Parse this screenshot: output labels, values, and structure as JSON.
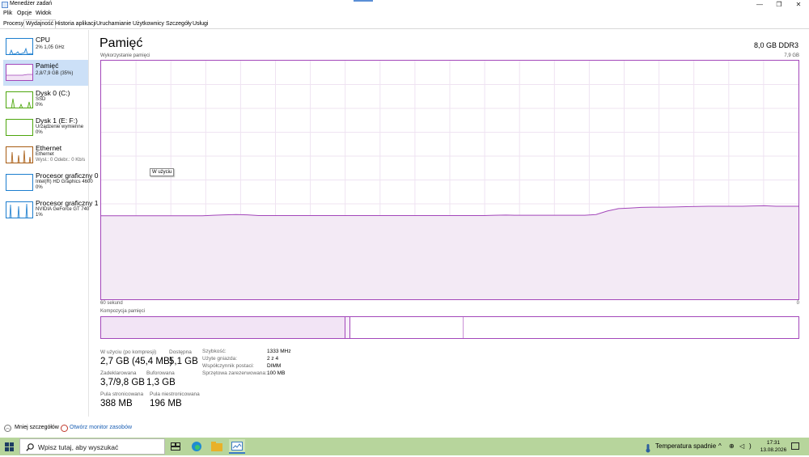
{
  "window": {
    "title": "Menedżer zadań",
    "controls": {
      "minimize": "—",
      "restore": "❐",
      "close": "✕"
    }
  },
  "menu": {
    "file": "Plik",
    "options": "Opcje",
    "view": "Widok"
  },
  "tabs": [
    {
      "label": "Procesy"
    },
    {
      "label": "Wydajność",
      "active": true
    },
    {
      "label": "Historia aplikacji"
    },
    {
      "label": "Uruchamianie"
    },
    {
      "label": "Użytkownicy"
    },
    {
      "label": "Szczegóły"
    },
    {
      "label": "Usługi"
    }
  ],
  "sidebar": {
    "items": [
      {
        "name": "CPU",
        "line1": "2% 1,05 GHz",
        "color": "#1c7ecf"
      },
      {
        "name": "Pamięć",
        "line1": "2,8/7,9 GB (35%)",
        "color": "#a347ba",
        "active": true
      },
      {
        "name": "Dysk 0 (C:)",
        "line1": "SSD",
        "line2": "0%",
        "color": "#4da60c"
      },
      {
        "name": "Dysk 1 (E: F:)",
        "line1": "Urządzenie wymienne",
        "line2": "0%",
        "color": "#4da60c"
      },
      {
        "name": "Ethernet",
        "line1": "Ethernet",
        "line2": "Wysł.: 0 Odebr.: 0 Kb/s",
        "color": "#a75b12"
      },
      {
        "name": "Procesor graficzny 0",
        "line1": "Intel(R) HD Graphics 4600",
        "line2": "0%",
        "color": "#1c7ecf"
      },
      {
        "name": "Procesor graficzny 1",
        "line1": "NVIDIA GeForce GT 740",
        "line2": "1%",
        "color": "#1c7ecf"
      }
    ]
  },
  "main": {
    "title": "Pamięć",
    "mem_type": "8,0 GB DDR3",
    "usage_caption": "Wykorzystanie pamięci",
    "usage_max": "7,9 GB",
    "time_left": "60 sekund",
    "time_right": "0",
    "tooltip": "W użyciu",
    "composition_caption": "Kompozycja pamięci",
    "composition": {
      "in_use_fraction": 0.35,
      "modified_fraction": 0.007,
      "standby_fraction": 0.162
    },
    "stats": {
      "in_use_label": "W użyciu (po kompresji)",
      "in_use_value": "2,7 GB (45,4 MB)",
      "available_label": "Dostępna",
      "available_value": "5,1 GB",
      "committed_label": "Zadeklarowana",
      "committed_value": "3,7/9,8 GB",
      "cached_label": "Buforowana",
      "cached_value": "1,3 GB",
      "paged_label": "Pula stronicowana",
      "paged_value": "388 MB",
      "nonpaged_label": "Pula niestronicowana",
      "nonpaged_value": "196 MB"
    },
    "specs": [
      {
        "k": "Szybkość:",
        "v": "1333 MHz"
      },
      {
        "k": "Użyte gniazda:",
        "v": "2 z 4"
      },
      {
        "k": "Współczynnik postaci:",
        "v": "DIMM"
      },
      {
        "k": "Sprzętowa zarezerwowana:",
        "v": "100 MB"
      }
    ],
    "usage_series_fraction": [
      0.35,
      0.35,
      0.35,
      0.35,
      0.35,
      0.35,
      0.35,
      0.35,
      0.35,
      0.35,
      0.352,
      0.354,
      0.355,
      0.354,
      0.351,
      0.351,
      0.351,
      0.351,
      0.351,
      0.351,
      0.351,
      0.351,
      0.351,
      0.351,
      0.351,
      0.351,
      0.351,
      0.351,
      0.351,
      0.351,
      0.351,
      0.351,
      0.351,
      0.351,
      0.351,
      0.352,
      0.353,
      0.352,
      0.352,
      0.352,
      0.352,
      0.352,
      0.352,
      0.352,
      0.355,
      0.37,
      0.38,
      0.382,
      0.385,
      0.386,
      0.386,
      0.387,
      0.388,
      0.389,
      0.39,
      0.39,
      0.39,
      0.39,
      0.391,
      0.392,
      0.39,
      0.39,
      0.39
    ]
  },
  "footer": {
    "fewer_details": "Mniej szczegółów",
    "open_monitor": "Otwórz monitor zasobów"
  },
  "taskbar": {
    "search_placeholder": "Wpisz tutaj, aby wyszukać",
    "weather": "Temperatura spadnie",
    "time": "17:31",
    "date": "13.08.2026"
  }
}
